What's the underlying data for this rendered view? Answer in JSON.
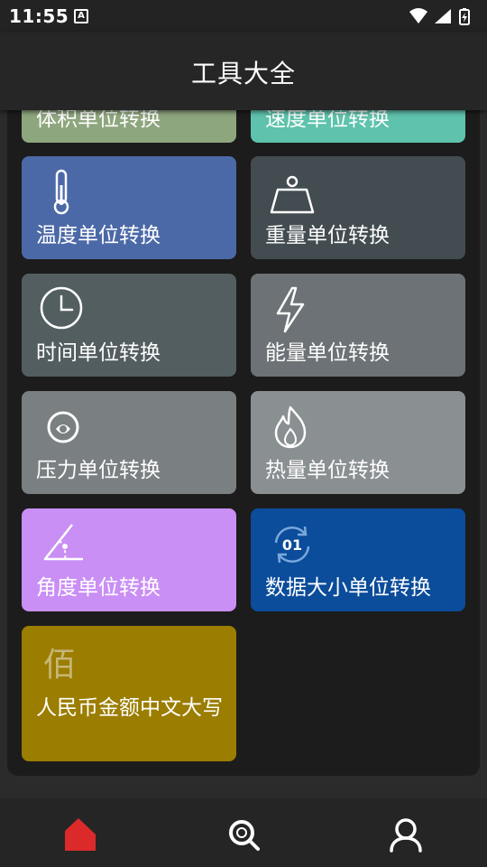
{
  "status": {
    "time": "11:55",
    "notification_badge": "A"
  },
  "header": {
    "title": "工具大全"
  },
  "colors": {
    "volume": "#8ea67e",
    "speed": "#5ec2ac",
    "temperature": "#4c69a7",
    "weight": "#434c50",
    "time": "#535e60",
    "energy": "#6c7275",
    "pressure": "#7a7f82",
    "heat": "#8a8f92",
    "angle": "#c98ff5",
    "data_size": "#0b4c9b",
    "rmb": "#9b7d00",
    "nav_active": "#dc2a2a"
  },
  "tools": [
    {
      "name": "volume",
      "label": "体积单位转换",
      "icon": ""
    },
    {
      "name": "speed",
      "label": "速度单位转换",
      "icon": ""
    },
    {
      "name": "temperature",
      "label": "温度单位转换",
      "icon": "thermometer-icon"
    },
    {
      "name": "weight",
      "label": "重量单位转换",
      "icon": "weight-icon"
    },
    {
      "name": "time",
      "label": "时间单位转换",
      "icon": "clock-icon"
    },
    {
      "name": "energy",
      "label": "能量单位转换",
      "icon": "lightning-icon"
    },
    {
      "name": "pressure",
      "label": "压力单位转换",
      "icon": "pressure-gauge-icon"
    },
    {
      "name": "heat",
      "label": "热量单位转换",
      "icon": "flame-icon"
    },
    {
      "name": "angle",
      "label": "角度单位转换",
      "icon": "angle-icon"
    },
    {
      "name": "data-size",
      "label": "数据大小单位转换",
      "icon": "data-cycle-icon",
      "icon_text": "01"
    },
    {
      "name": "rmb",
      "label": "人民币金额中文大写",
      "icon": "bai-character-icon",
      "icon_text": "佰"
    }
  ],
  "bottom_nav": [
    {
      "name": "home",
      "icon": "home-icon",
      "active": true
    },
    {
      "name": "search",
      "icon": "search-icon",
      "active": false
    },
    {
      "name": "profile",
      "icon": "user-icon",
      "active": false
    }
  ]
}
